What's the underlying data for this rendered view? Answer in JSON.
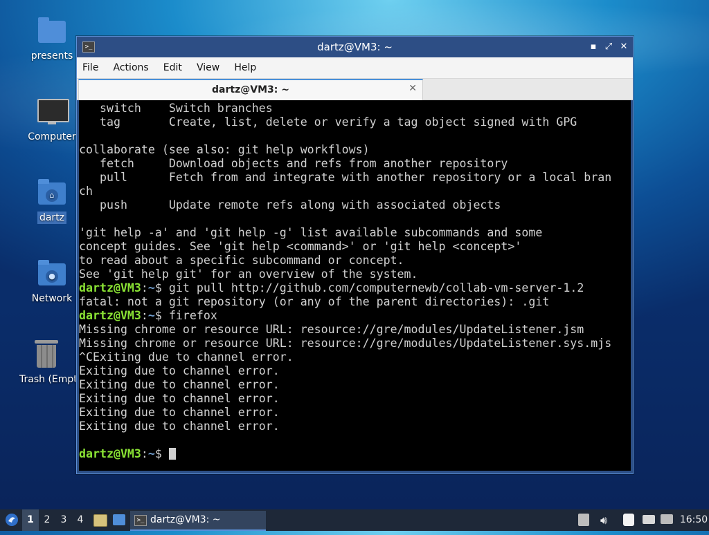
{
  "desktop": {
    "icons": [
      {
        "label": "presents"
      },
      {
        "label": "Computer"
      },
      {
        "label": "dartz"
      },
      {
        "label": "Network"
      },
      {
        "label": "Trash (Empty)"
      }
    ]
  },
  "window": {
    "title": "dartz@VM3: ~",
    "menu": [
      "File",
      "Actions",
      "Edit",
      "View",
      "Help"
    ],
    "tab_title": "dartz@VM3: ~",
    "prompt_user": "dartz@VM3",
    "prompt_path": "~",
    "terminal": {
      "lines_top": [
        "   switch    Switch branches",
        "   tag       Create, list, delete or verify a tag object signed with GPG",
        "",
        "collaborate (see also: git help workflows)",
        "   fetch     Download objects and refs from another repository",
        "   pull      Fetch from and integrate with another repository or a local bran",
        "ch",
        "   push      Update remote refs along with associated objects",
        "",
        "'git help -a' and 'git help -g' list available subcommands and some",
        "concept guides. See 'git help <command>' or 'git help <concept>'",
        "to read about a specific subcommand or concept.",
        "See 'git help git' for an overview of the system."
      ],
      "cmd1": "git pull http://github.com/computernewb/collab-vm-server-1.2",
      "out1": "fatal: not a git repository (or any of the parent directories): .git",
      "cmd2": "firefox",
      "lines_after": [
        "Missing chrome or resource URL: resource://gre/modules/UpdateListener.jsm",
        "Missing chrome or resource URL: resource://gre/modules/UpdateListener.sys.mjs",
        "^CExiting due to channel error.",
        "Exiting due to channel error.",
        "Exiting due to channel error.",
        "Exiting due to channel error.",
        "Exiting due to channel error.",
        "Exiting due to channel error.",
        ""
      ]
    }
  },
  "taskbar": {
    "workspaces": [
      "1",
      "2",
      "3",
      "4"
    ],
    "active_workspace": "1",
    "task_label": "dartz@VM3: ~",
    "clock": "16:50"
  }
}
